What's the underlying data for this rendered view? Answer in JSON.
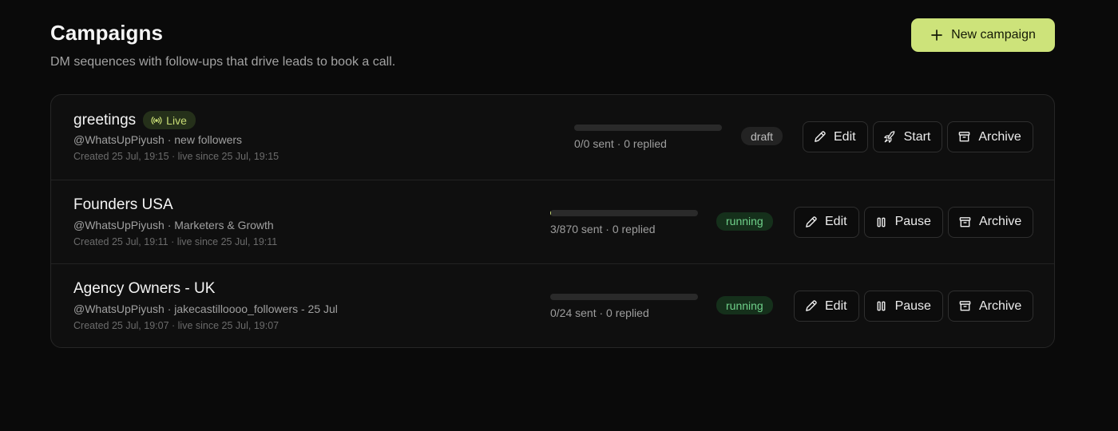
{
  "header": {
    "title": "Campaigns",
    "subtitle": "DM sequences with follow-ups that drive leads to book a call.",
    "new_button": {
      "label": "New campaign",
      "icon": "plus-icon"
    }
  },
  "campaigns": [
    {
      "name": "greetings",
      "live_badge": "Live",
      "subline": "@WhatsUpPiyush · new followers",
      "meta": "Created 25 Jul, 19:15 · live since 25 Jul, 19:15",
      "progress_fraction": 0,
      "sent_text": "0/0 sent · 0 replied",
      "status": "draft",
      "actions": [
        {
          "label": "Edit",
          "icon": "pencil-icon"
        },
        {
          "label": "Start",
          "icon": "rocket-icon"
        },
        {
          "label": "Archive",
          "icon": "archive-icon"
        }
      ]
    },
    {
      "name": "Founders USA",
      "subline": "@WhatsUpPiyush · Marketers & Growth",
      "meta": "Created 25 Jul, 19:11 · live since 25 Jul, 19:11",
      "progress_fraction": 0.003,
      "sent_text": "3/870 sent · 0 replied",
      "status": "running",
      "actions": [
        {
          "label": "Edit",
          "icon": "pencil-icon"
        },
        {
          "label": "Pause",
          "icon": "pause-icon"
        },
        {
          "label": "Archive",
          "icon": "archive-icon"
        }
      ]
    },
    {
      "name": "Agency Owners - UK",
      "subline": "@WhatsUpPiyush · jakecastilloooo_followers - 25 Jul",
      "meta": "Created 25 Jul, 19:07 · live since 25 Jul, 19:07",
      "progress_fraction": 0,
      "sent_text": "0/24 sent · 0 replied",
      "status": "running",
      "actions": [
        {
          "label": "Edit",
          "icon": "pencil-icon"
        },
        {
          "label": "Pause",
          "icon": "pause-icon"
        },
        {
          "label": "Archive",
          "icon": "archive-icon"
        }
      ]
    }
  ],
  "colors": {
    "accent": "#cde37a",
    "running_text": "#6fd08a",
    "running_bg": "#15301b",
    "draft_bg": "#232323",
    "live_text": "#c8dc74",
    "background": "#0a0a0a"
  }
}
